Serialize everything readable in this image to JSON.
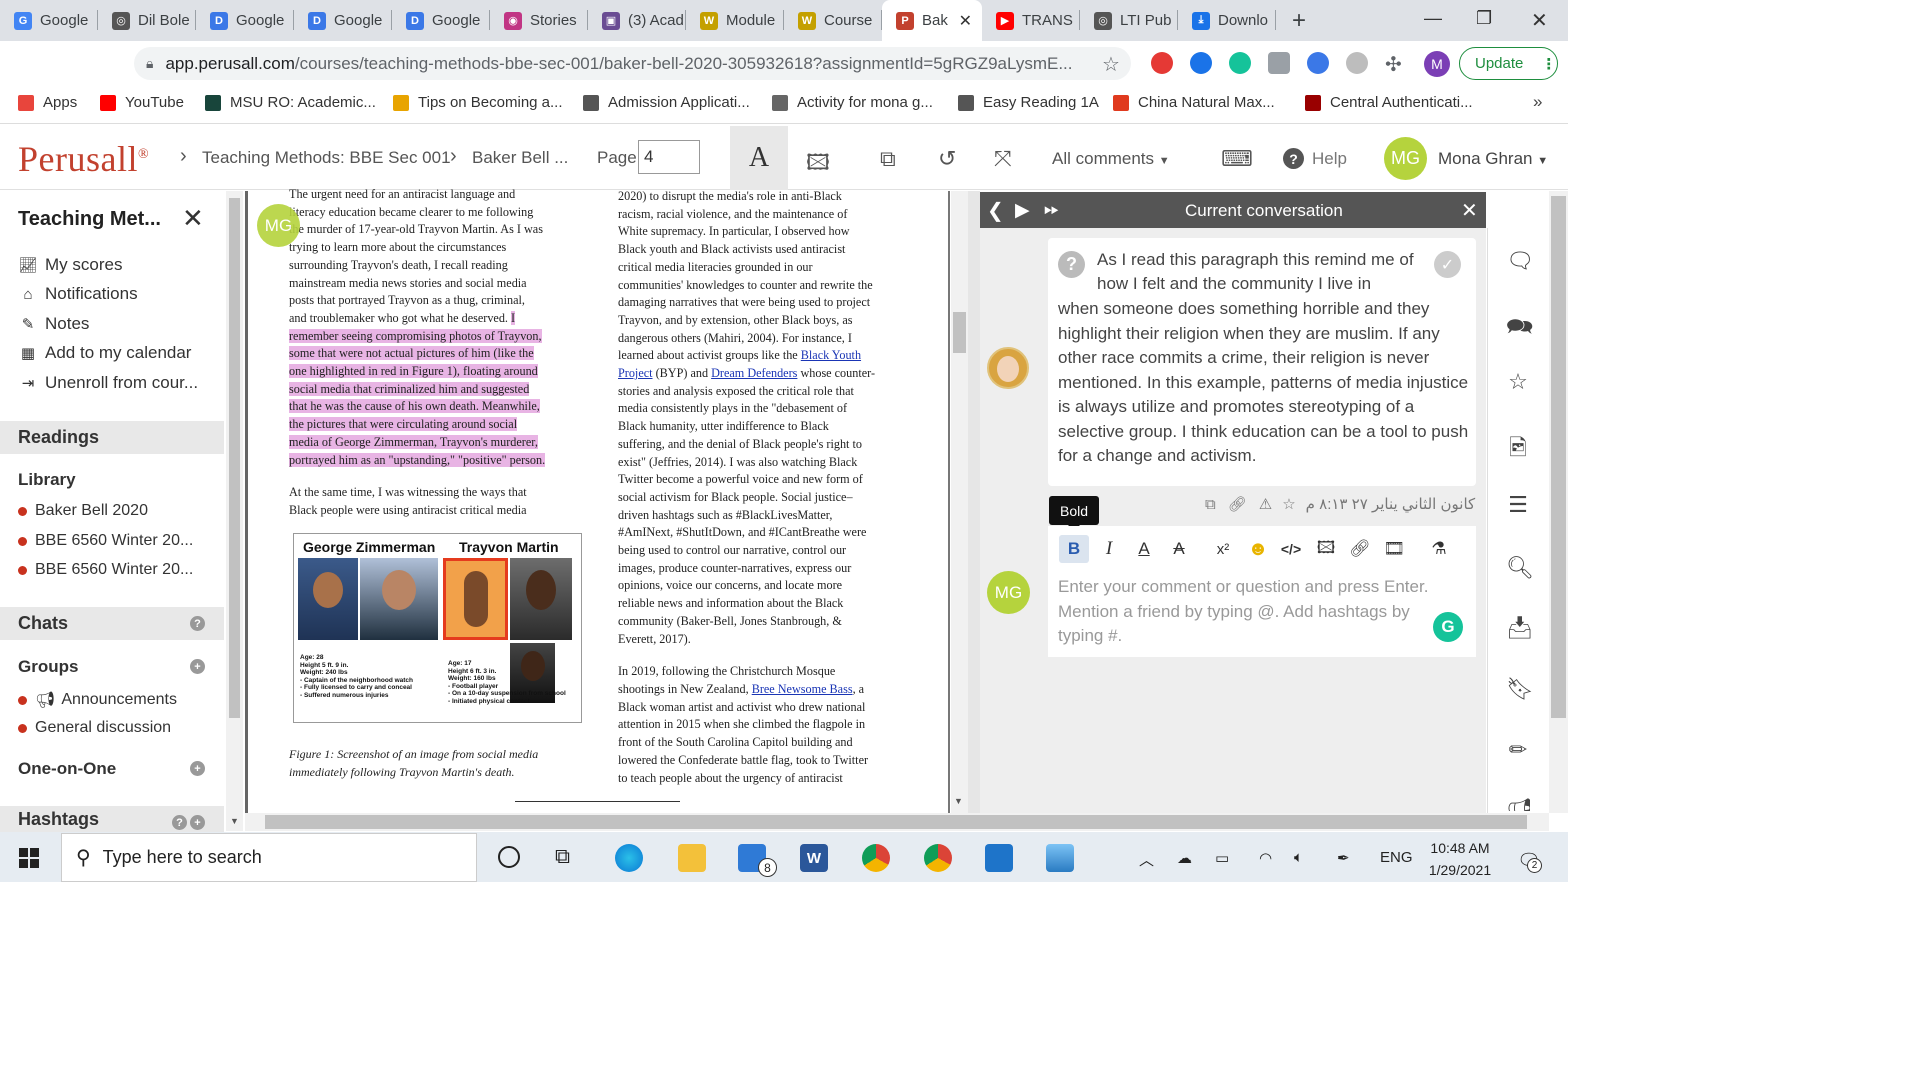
{
  "browser": {
    "tabs": [
      {
        "label": "Google",
        "color": "#4285f4",
        "glyph": "G"
      },
      {
        "label": "Dil Bole",
        "color": "#555555",
        "glyph": "◎"
      },
      {
        "label": "Google",
        "color": "#3b78e7",
        "glyph": "D"
      },
      {
        "label": "Google",
        "color": "#3b78e7",
        "glyph": "D"
      },
      {
        "label": "Google",
        "color": "#3b78e7",
        "glyph": "D"
      },
      {
        "label": "Stories",
        "color": "#c13584",
        "glyph": "◉"
      },
      {
        "label": "(3) Acad",
        "color": "#6a4c93",
        "glyph": "▣"
      },
      {
        "label": "Module",
        "color": "#c4a000",
        "glyph": "W"
      },
      {
        "label": "Course",
        "color": "#c4a000",
        "glyph": "W"
      },
      {
        "label": "Bak",
        "color": "#c2412e",
        "glyph": "P"
      },
      {
        "label": "TRANS",
        "color": "#ff0000",
        "glyph": "▶"
      },
      {
        "label": "LTI Pub",
        "color": "#555555",
        "glyph": "◎"
      },
      {
        "label": "Downlo",
        "color": "#1a73e8",
        "glyph": "⤓"
      }
    ],
    "url_main": "app.perusall.com",
    "url_rest": "/courses/teaching-methods-bbe-sec-001/baker-bell-2020-305932618?assignmentId=5gRGZ9aLysmE...",
    "update_label": "Update",
    "profile_initial": "M",
    "bookmarks": [
      {
        "label": "Apps",
        "color": "#e8453c"
      },
      {
        "label": "YouTube",
        "color": "#ff0000"
      },
      {
        "label": "MSU RO: Academic...",
        "color": "#18453b"
      },
      {
        "label": "Tips on Becoming a...",
        "color": "#e8a400"
      },
      {
        "label": "Admission Applicati...",
        "color": "#555555"
      },
      {
        "label": "Activity for mona g...",
        "color": "#666666"
      },
      {
        "label": "Easy Reading 1A",
        "color": "#555555"
      },
      {
        "label": "China Natural Max...",
        "color": "#e03a1e"
      },
      {
        "label": "Central Authenticati...",
        "color": "#990000"
      }
    ]
  },
  "header": {
    "logo": "Perusall",
    "logo_reg": "®",
    "crumb1": "Teaching Methods: BBE Sec 001",
    "crumb2": "Baker Bell ...",
    "page_label": "Page",
    "page_value": "4",
    "comments_filter": "All comments",
    "help": "Help",
    "user_initials": "MG",
    "user_name": "Mona Ghran"
  },
  "sidebar": {
    "title": "Teaching Met...",
    "links": [
      {
        "label": "My scores",
        "icon": "chart-icon"
      },
      {
        "label": "Notifications",
        "icon": "inbox-icon"
      },
      {
        "label": "Notes",
        "icon": "pencil-icon"
      },
      {
        "label": "Add to my calendar",
        "icon": "calendar-icon"
      },
      {
        "label": "Unenroll from cour...",
        "icon": "signout-icon"
      }
    ],
    "readings": "Readings",
    "library": "Library",
    "library_items": [
      "Baker Bell 2020",
      "BBE 6560 Winter 20...",
      "BBE 6560 Winter 20..."
    ],
    "chats": "Chats",
    "groups": "Groups",
    "group_items": [
      "Announcements",
      "General discussion"
    ],
    "one_on_one": "One-on-One",
    "hashtags": "Hashtags"
  },
  "document": {
    "col1_top": [
      "The urgent need for an antiracist language and",
      "literacy education became clearer to me following",
      "the murder of 17-year-old Trayvon Martin. As I was",
      "trying to learn more about the circumstances",
      "surrounding Trayvon's death, I recall reading",
      "mainstream media news stories and social media",
      "posts that portrayed Trayvon as a thug, criminal,"
    ],
    "col1_line8_plain": "and troublemaker who got what he deserved. ",
    "col1_line8_hl": "I",
    "col1_hl": [
      "remember seeing compromising photos of Trayvon,",
      "some that were not actual pictures of him (like the",
      "one highlighted in red in Figure 1), floating around",
      "social media that criminalized him and suggested",
      "that he was the cause of his own death. Meanwhile,",
      "the pictures that were circulating around social",
      "media of George Zimmerman, Trayvon's murderer,",
      "portrayed him as an \"upstanding,\" \"positive\" person."
    ],
    "col1_after": [
      "At the same time, I was witnessing the ways that",
      "Black people were using antiracist critical media"
    ],
    "figure_left": "George Zimmerman",
    "figure_right": "Trayvon Martin",
    "fig_left_info": [
      "Age: 28",
      "Height 5 ft. 9 in.",
      "Weight: 240 lbs",
      "- Captain of the neighborhood watch",
      "- Fully licensed to carry and conceal",
      "- Suffered numerous injuries"
    ],
    "fig_right_info": [
      "Age: 17",
      "Height 6 ft. 3 in.",
      "Weight: 160 lbs",
      "- Football player",
      "- On a 10-day suspension from school",
      "- Initiated physical contact"
    ],
    "caption": "Figure 1: Screenshot of an image from social media immediately following Trayvon Martin's death.",
    "col2_a": [
      "2020) to disrupt the media's role in anti-Black",
      "racism, racial violence, and the maintenance of",
      "White supremacy. In particular, I observed how",
      "Black youth and Black activists used antiracist",
      "critical media literacies grounded in our",
      "communities' knowledges to counter and rewrite the",
      "damaging narratives that were being used to project",
      "Trayvon, and by extension, other Black boys, as",
      "dangerous others (Mahiri, 2004). For instance, I"
    ],
    "col2_b_pre": "learned about activist groups like the ",
    "col2_b_link": "Black Youth",
    "col2_c_link1": "Project",
    "col2_c_mid": " (BYP) and ",
    "col2_c_link2": "Dream Defenders",
    "col2_c_post": " whose counter-",
    "col2_d": [
      "stories and analysis exposed the critical role that",
      "media consistently plays in the \"debasement of",
      "Black humanity, utter indifference to Black",
      "suffering, and the denial of Black people's right to",
      "exist\" (Jeffries, 2014). I was also watching Black",
      "Twitter become a powerful voice and new form of",
      "social activism for Black people. Social justice–",
      "driven hashtags such as #BlackLivesMatter,",
      "#AmINext, #ShutItDown, and #ICantBreathe were",
      "being used to control our narrative, control our",
      "images, produce counter-narratives, express our",
      "opinions, voice our concerns, and locate more",
      "reliable news and information about the Black",
      "community (Baker-Bell, Jones Stanbrough, &",
      "Everett, 2017)."
    ],
    "col2_e1": "In 2019, following the Christchurch Mosque",
    "col2_e2_pre": "shootings in New Zealand, ",
    "col2_e2_link": "Bree Newsome Bass",
    "col2_e2_post": ", a",
    "col2_f": [
      "Black woman artist and activist who drew national",
      "attention in 2015 when she climbed the flagpole in",
      "front of the South Carolina Capitol building and",
      "lowered the Confederate battle flag, took to Twitter",
      "to teach people about the urgency of antiracist"
    ],
    "marker_initials": "MG"
  },
  "conversation": {
    "title": "Current conversation",
    "comment": "As I read this paragraph this remind me of how I felt and the community I live in when someone does something horrible and they highlight their religion when they are muslim. If any other race commits a crime, their religion is never mentioned. In this example, patterns of media injustice is always utilize and promotes stereotyping of a selective group. I think education can be a tool to push for a change and activism.",
    "comment_first_line": "As I read this paragraph this remind me of",
    "comment_second_line": "how I felt and the community I live in",
    "comment_rest": "when someone does something horrible and they highlight their religion when they are muslim. If any other race commits a crime, their religion is never mentioned. In this example, patterns of media injustice is always utilize and promotes stereotyping of a selective group. I think education can be a tool to push for a change and activism.",
    "timestamp": "كانون الثاني يناير ٢٧ ٨:١٣ م",
    "tooltip": "Bold",
    "input_placeholder": "Enter your comment or question and press Enter. Mention a friend by typing @. Add hashtags by typing #.",
    "input_initials": "MG"
  },
  "taskbar": {
    "search_placeholder": "Type here to search",
    "lang": "ENG",
    "time": "10:48 AM",
    "date": "1/29/2021",
    "mail_badge": "8",
    "notif_badge": "2"
  }
}
